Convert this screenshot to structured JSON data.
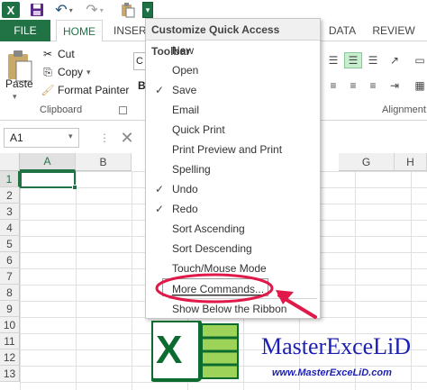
{
  "qat": {
    "logo_letter": "X",
    "dropdown_glyph": "▾"
  },
  "tabs": [
    {
      "label": "FILE"
    },
    {
      "label": "HOME"
    },
    {
      "label": "INSERT"
    },
    {
      "label": "DATA"
    },
    {
      "label": "REVIEW"
    }
  ],
  "ribbon": {
    "paste_label": "Paste",
    "cut_label": "Cut",
    "copy_label": "Copy",
    "format_painter_label": "Format Painter",
    "clipboard_group": "Clipboard",
    "alignment_group": "Alignment",
    "font_name_partial": "C",
    "bold_letter": "B"
  },
  "formula_bar": {
    "name_box": "A1",
    "separator": "⋮"
  },
  "grid": {
    "columns": [
      "A",
      "B",
      "G",
      "H"
    ],
    "rows": [
      "1",
      "2",
      "3",
      "4",
      "5",
      "6",
      "7",
      "8",
      "9",
      "10",
      "11",
      "12",
      "13"
    ]
  },
  "menu": {
    "title": "Customize Quick Access Toolbar",
    "items": [
      {
        "label": "New",
        "checked": false
      },
      {
        "label": "Open",
        "checked": false
      },
      {
        "label": "Save",
        "checked": true
      },
      {
        "label": "Email",
        "checked": false
      },
      {
        "label": "Quick Print",
        "checked": false
      },
      {
        "label": "Print Preview and Print",
        "checked": false
      },
      {
        "label": "Spelling",
        "checked": false
      },
      {
        "label": "Undo",
        "checked": true
      },
      {
        "label": "Redo",
        "checked": true
      },
      {
        "label": "Sort Ascending",
        "checked": false
      },
      {
        "label": "Sort Descending",
        "checked": false
      },
      {
        "label": "Touch/Mouse Mode",
        "checked": false
      }
    ],
    "more_commands": "More Commands...",
    "show_below": "Show Below the Ribbon",
    "check_glyph": "✓"
  },
  "brand": {
    "name": "MasterExceLiD",
    "url": "www.MasterExceLiD.com",
    "logo_letter": "X"
  },
  "colors": {
    "excel_green": "#217346",
    "annotation_red": "#e0194a",
    "brand_blue": "#1b1fb3"
  }
}
